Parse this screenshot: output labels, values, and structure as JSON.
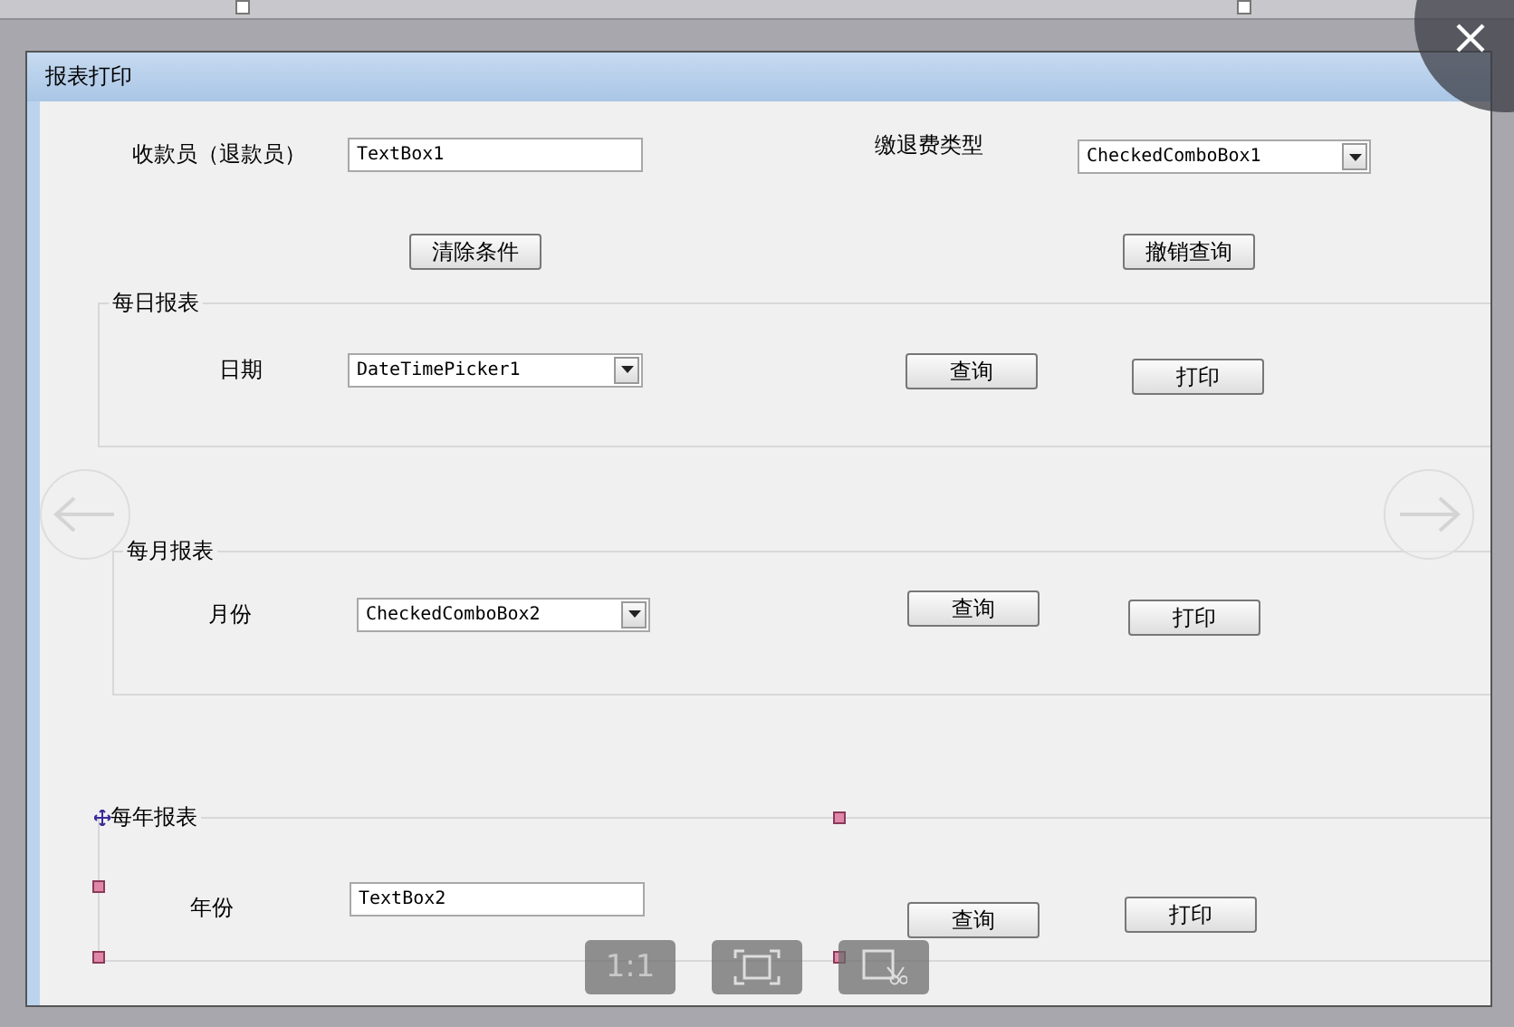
{
  "window": {
    "title": "报表打印"
  },
  "filters": [
    {
      "label": "收款员（退款员）",
      "field": {
        "kind": "textbox",
        "value": "TextBox1"
      }
    },
    {
      "label": "缴退费类型",
      "field": {
        "kind": "combo",
        "value": "CheckedComboBox1"
      }
    }
  ],
  "filter_buttons": [
    "清除条件",
    "撤销查询"
  ],
  "groups": [
    {
      "title": "每日报表",
      "selected": false,
      "label": "日期",
      "field": {
        "kind": "combo",
        "value": "DateTimePicker1"
      },
      "buttons": [
        "查询",
        "打印"
      ]
    },
    {
      "title": "每月报表",
      "selected": false,
      "label": "月份",
      "field": {
        "kind": "combo",
        "value": "CheckedComboBox2"
      },
      "buttons": [
        "查询",
        "打印"
      ]
    },
    {
      "title": "每年报表",
      "selected": true,
      "label": "年份",
      "field": {
        "kind": "textbox",
        "value": "TextBox2"
      },
      "buttons": [
        "查询",
        "打印"
      ]
    }
  ],
  "viewer": {
    "zoom_label": "1:1"
  }
}
